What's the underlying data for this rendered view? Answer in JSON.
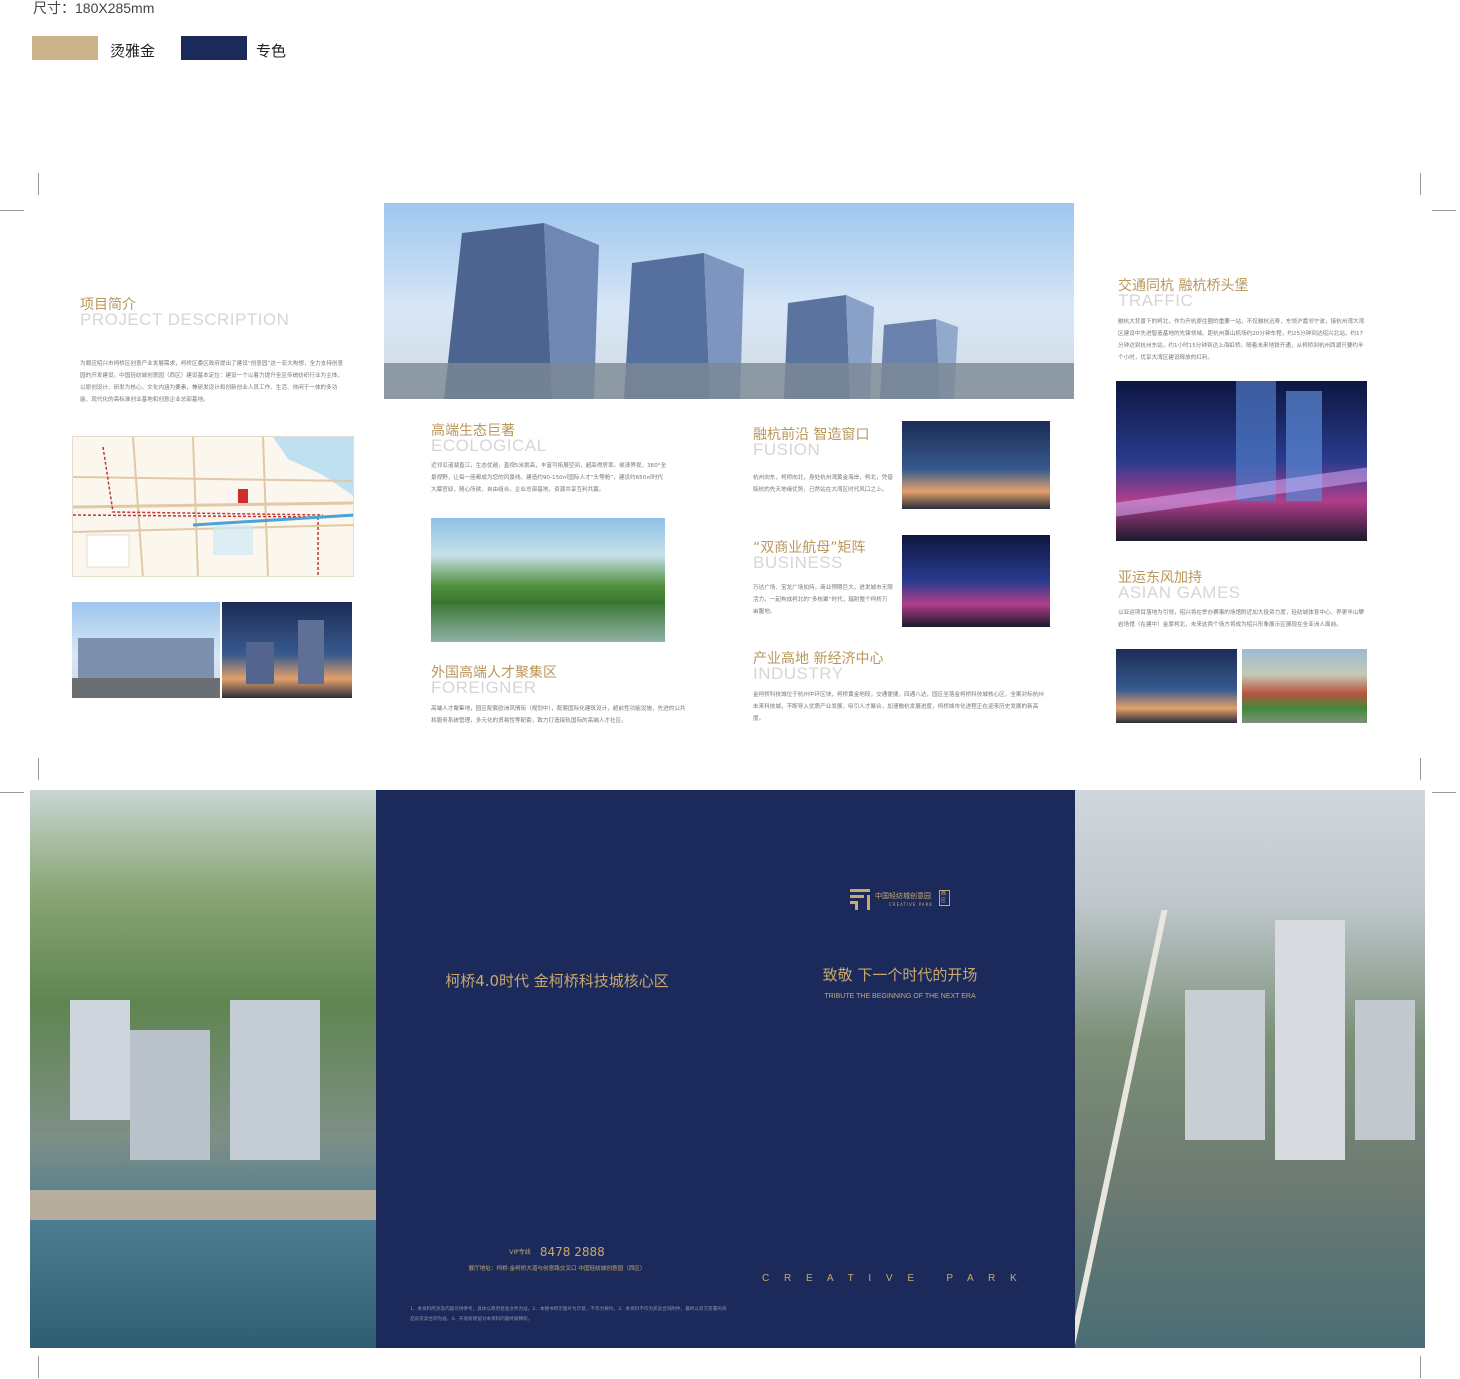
{
  "spec": "尺寸：180X285mm",
  "legend": [
    {
      "label": "烫雅金",
      "color": "#cbb48a"
    },
    {
      "label": "专色",
      "color": "#1b2a5a"
    }
  ],
  "inside": {
    "project": {
      "title": "项目简介",
      "subtitle": "PROJECT DESCRIPTION",
      "body": "为顺应绍兴市柯桥区创意产业发展需求，柯桥区委区政府提出了建设“创意园”这一宏大构想，全力支持创意园的开发建设。中国轻纺城创意园（西区）建设基本定位：建设一个以着力提升全区传统纺织行业为主体，以原创设计、研发为核心，文化内涵为要素，兼研发设计和创新创业人员工作、生活、休闲于一体的多功能、现代化的高标准创业基地和创意企业总部基地。"
    },
    "ecological": {
      "title": "高端生态巨著",
      "subtitle": "ECOLOGICAL",
      "body": "近邻瓜渚湖直江，生态优越，直视5米挑高，丰富可拓展空间，超高得房率。侯潇界视，360°全景视野，让每一座都成为您的风景线。建造约90-150㎡国际人才“头等舱”，建设约650㎡时代大幕官邸，随心所欲，自由组合。企业总部基地，资源共享互利共赢。"
    },
    "fusion": {
      "title": "融杭前沿 智造窗口",
      "subtitle": "FUSION",
      "body": "杭州向东，柯桥向北，身处杭州湾黄金海岸，柯北，凭借临杭的先天地缘优势，已然站在大湾区时代风口之上。"
    },
    "business": {
      "title": "“双商业航母”矩阵",
      "subtitle": "BUSINESS",
      "body": "万达广场、宝龙广场加持，商业预期巨大，迸发城市无限活力，一起构成柯北的“多核聚”时代，辐射整个柯桥万亩腹地。"
    },
    "foreigner": {
      "title": "外国高端人才聚集区",
      "subtitle": "FOREIGNER",
      "body": "高端人才聚集地，园区配套欧洲风情街（规划中），配套国际化建筑设计，超前性功能设施，先进的公共和服务系统管理，多元化的贸易性等配套，致力打造接轨国际的高端人才社区。"
    },
    "industry": {
      "title": "产业高地 新经济中心",
      "subtitle": "INDUSTRY",
      "body": "金柯桥科技城位于杭州中环区块，柯桥黄金地段，交通便捷，四通八达，园区坐落金柯桥科技城核心区，全案对标杭州未来科技城，不断导入优质产业发展，吸引人才聚合，加速融杭发展进度，柯桥城市化进程正在迎来历史发展的新高度。"
    },
    "traffic": {
      "title": "交通同杭 融杭桥头堡",
      "subtitle": "TRAFFIC",
      "body": "融杭大背景下的柯北，作为开杭原住圈的重要一站，不仅融杭迅寿，东领沪嘉邻宁波，接杭州湾大湾区建设中先进智造基地的先锋领域。距杭州萧山机场约20分钟车程，约25分钟到达绍兴北站，约17分钟达到杭州东站，约1小时15分钟到达上海虹桥。随着未来地铁开通，从柯桥到杭州西湖只要约半个小时，优享大湾区建设释放的红利。"
    },
    "asian_games": {
      "title": "亚运东风加持",
      "subtitle": "ASIAN GAMES",
      "body": "以亚运项目落地为引领，绍兴将在举办赛事的场馆附近加大投资力度，轻纺城体育中心、养更羊山攀岩场馆（在建中）金厚柯北，未来这两个场方将成为绍兴形象展示区展现在全亚洲人面前。"
    }
  },
  "outside": {
    "slogan_left": "柯桥4.0时代  金柯桥科技城核心区",
    "hotline_prefix": "VIP专线",
    "hotline": "8478 2888",
    "address": "展厅地址：柯桥·金柯桥大道与创意路交叉口 中国轻纺城创意园（西区）",
    "disclaimer": "1、本资料所涉及内容仅供参考，具体以政府批准文件为准。2、本楼书所示图片为示意，不作为要约。3、本资料不作为买卖合同附件，最终以双方签署的商品房买卖合同为准。4、开发商保留对本资料的最终解释权。",
    "logo_cn": "中国轻纺城创意园",
    "logo_tag": "西区",
    "logo_en": "CREATIVE PARK",
    "tagline_cn": "致敬 下一个时代的开场",
    "tagline_en": "TRIBUTE  THE BEGINNING OF THE NEXT ERA",
    "brand_spaced": "C R E A T I V E   P A R K"
  },
  "colors": {
    "gold": "#b9975b",
    "navy": "#1b2a5a"
  }
}
